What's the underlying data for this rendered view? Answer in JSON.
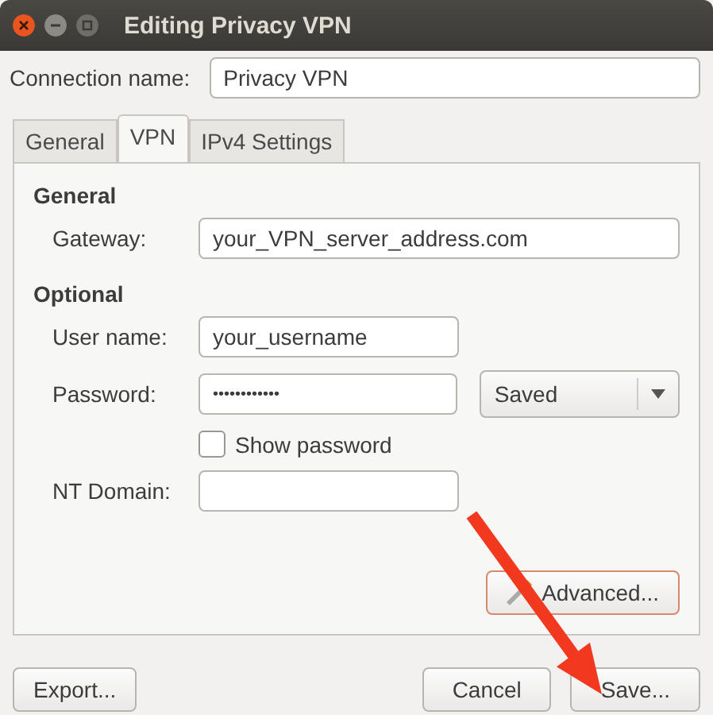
{
  "window": {
    "title": "Editing Privacy VPN"
  },
  "connection_name": {
    "label": "Connection name:",
    "value": "Privacy VPN"
  },
  "tabs": [
    {
      "label": "General",
      "selected": false
    },
    {
      "label": "VPN",
      "selected": true
    },
    {
      "label": "IPv4 Settings",
      "selected": false
    }
  ],
  "general": {
    "heading": "General",
    "gateway": {
      "label": "Gateway:",
      "value": "your_VPN_server_address.com"
    }
  },
  "optional": {
    "heading": "Optional",
    "user_name": {
      "label": "User name:",
      "value": "your_username"
    },
    "password": {
      "label": "Password:",
      "value": "••••••••••••",
      "storage": "Saved"
    },
    "show_password": {
      "label": "Show password",
      "checked": false
    },
    "nt_domain": {
      "label": "NT Domain:"
    },
    "advanced_button": "Advanced..."
  },
  "buttons": [
    {
      "label": "Export...",
      "kind": "left"
    },
    {
      "label": "Cancel",
      "kind": "right"
    },
    {
      "label": "Save...",
      "kind": "right"
    }
  ]
}
